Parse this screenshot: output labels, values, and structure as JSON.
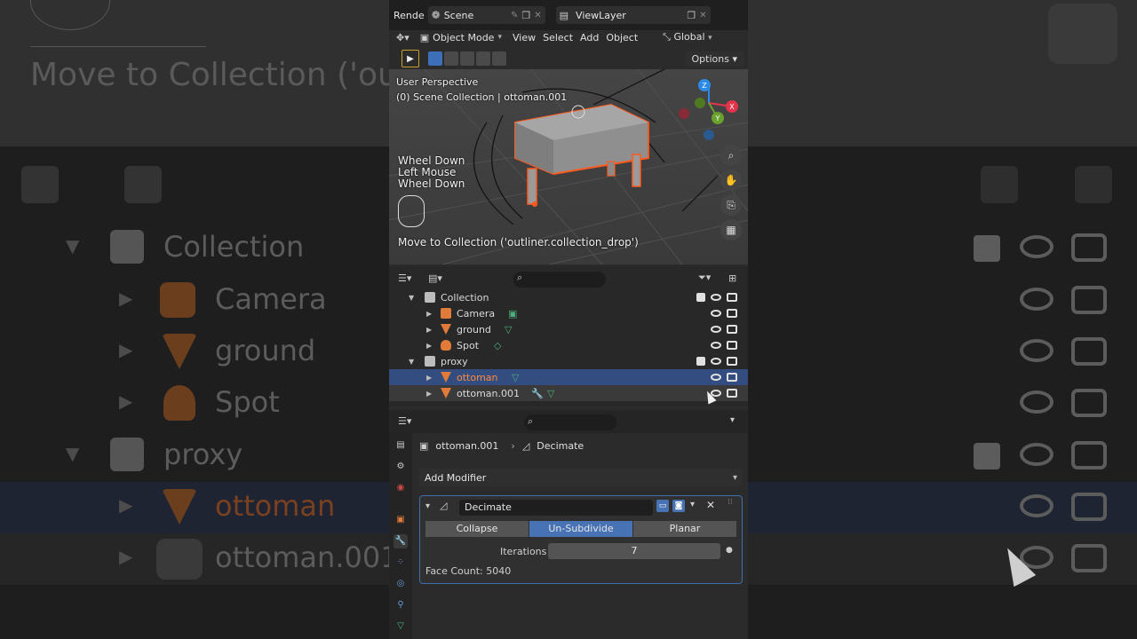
{
  "background": {
    "title": "Move to Collection ('ou",
    "rows": [
      {
        "label": "Collection",
        "indent": 0
      },
      {
        "label": "Camera",
        "indent": 1
      },
      {
        "label": "ground",
        "indent": 1
      },
      {
        "label": "Spot",
        "indent": 1
      },
      {
        "label": "proxy",
        "indent": 0
      },
      {
        "label": "ottoman",
        "indent": 1
      },
      {
        "label": "ottoman.001",
        "indent": 1
      }
    ]
  },
  "topbar": {
    "render_label": "Rende",
    "scene": "Scene",
    "view_layer": "ViewLayer"
  },
  "view_header": {
    "mode": "Object Mode",
    "menus": [
      "View",
      "Select",
      "Add",
      "Object"
    ],
    "transform": "Global",
    "options": "Options"
  },
  "viewport": {
    "perspective": "User Perspective",
    "context": "(0) Scene Collection | ottoman.001",
    "input_log": [
      "Wheel Down",
      "Left Mouse",
      "Wheel Down"
    ],
    "operator": "Move to Collection ('outliner.collection_drop')",
    "gizmo": {
      "x": "X",
      "y": "Y",
      "z": "Z"
    },
    "colors": {
      "selection": "#ff5a1f",
      "x_axis": "#e3344c",
      "y_axis": "#6aa02c",
      "z_axis": "#2c8be8"
    }
  },
  "outliner": {
    "rows": [
      {
        "label": "Collection",
        "type": "collection",
        "checkbox": true
      },
      {
        "label": "Camera",
        "type": "camera"
      },
      {
        "label": "ground",
        "type": "mesh"
      },
      {
        "label": "Spot",
        "type": "light"
      },
      {
        "label": "proxy",
        "type": "collection",
        "checkbox": true
      },
      {
        "label": "ottoman",
        "type": "mesh",
        "state": "selected"
      },
      {
        "label": "ottoman.001",
        "type": "mesh",
        "state": "active",
        "has_modifier": true
      }
    ]
  },
  "properties": {
    "object": "ottoman.001",
    "modifier": "Decimate",
    "add_modifier": "Add Modifier",
    "modifier_panel": {
      "name": "Decimate",
      "modes": [
        "Collapse",
        "Un-Subdivide",
        "Planar"
      ],
      "active_mode": "Un-Subdivide",
      "iterations_label": "Iterations",
      "iterations": "7",
      "face_count": "Face Count: 5040"
    }
  }
}
